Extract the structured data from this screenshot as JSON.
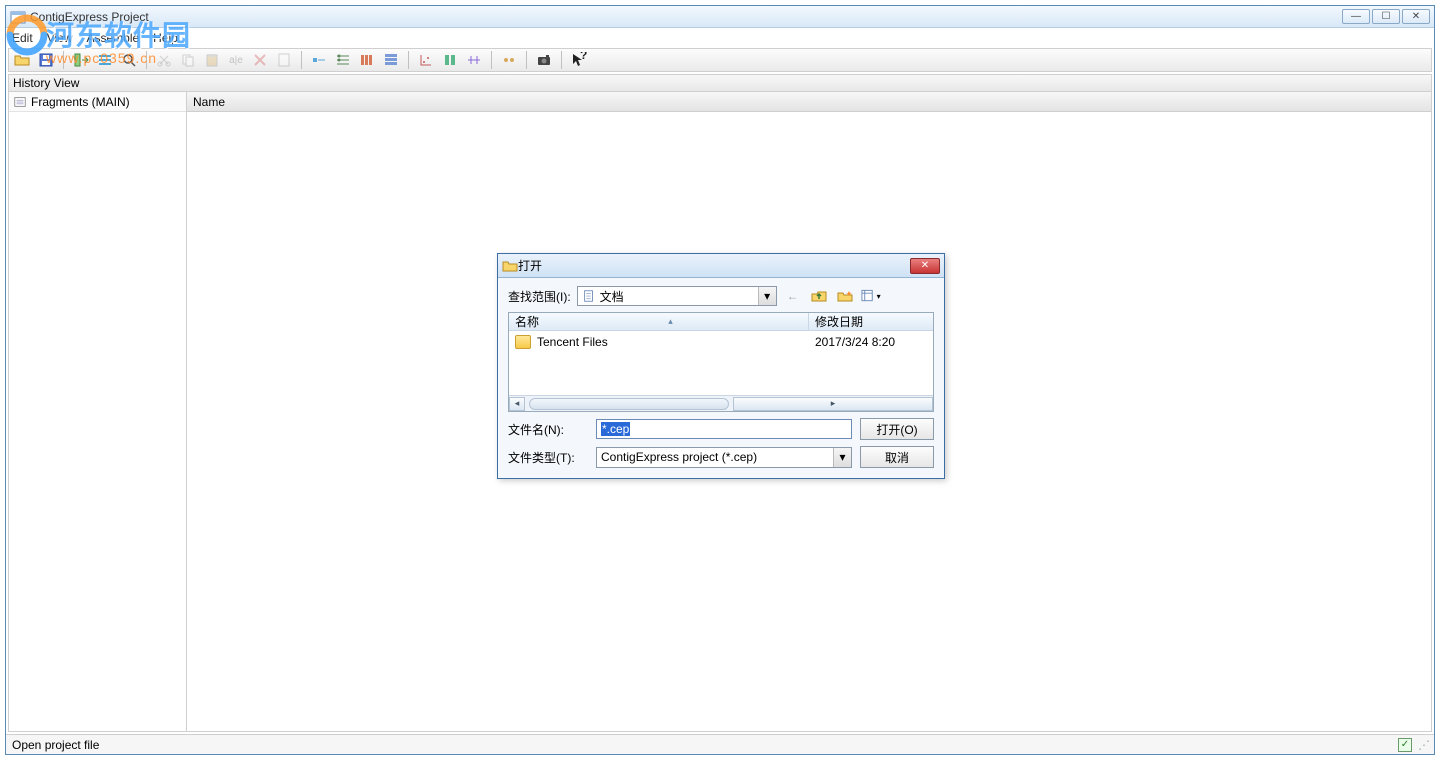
{
  "window": {
    "title": "ContigExpress Project"
  },
  "menu": {
    "edit": "Edit",
    "view": "View",
    "assemble": "Assemble",
    "help": "Help"
  },
  "history_header": "History View",
  "left_tree": {
    "fragments": "Fragments (MAIN)"
  },
  "right_header": {
    "name": "Name"
  },
  "status": {
    "text": "Open project file"
  },
  "watermark": {
    "big": "河东软件园",
    "url": "www.pc0359.cn"
  },
  "dialog": {
    "title": "打开",
    "lookin_label": "查找范围(I):",
    "lookin_value": "文档",
    "columns": {
      "name": "名称",
      "date": "修改日期"
    },
    "rows": [
      {
        "name": "Tencent Files",
        "date": "2017/3/24 8:20"
      }
    ],
    "filename_label": "文件名(N):",
    "filename_value": "*.cep",
    "filetype_label": "文件类型(T):",
    "filetype_value": "ContigExpress project (*.cep)",
    "open_btn": "打开(O)",
    "cancel_btn": "取消"
  },
  "icons": {
    "back": "←",
    "up": "↑"
  }
}
